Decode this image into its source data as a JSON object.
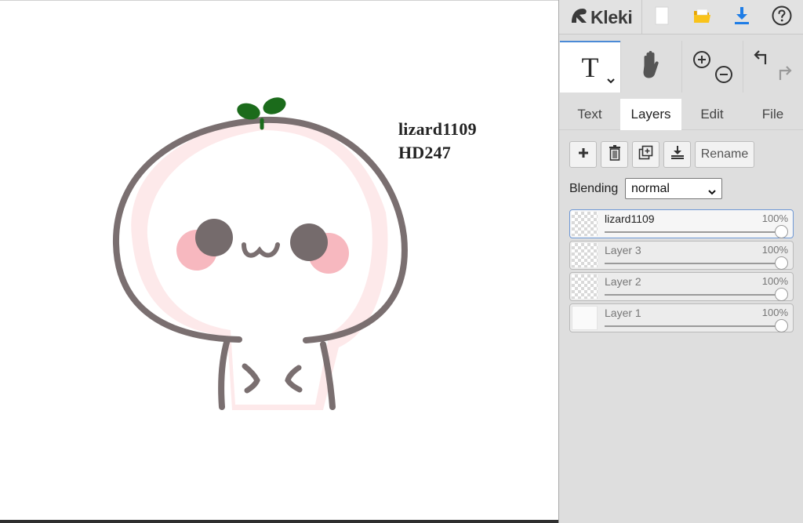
{
  "app": {
    "name": "Kleki"
  },
  "topbar": {
    "icons": [
      "kleki-logo-icon",
      "new-image-icon",
      "open-folder-icon",
      "download-icon",
      "help-icon"
    ],
    "colors": {
      "folder": "#f2b705",
      "download": "#1f7de6"
    }
  },
  "tools": {
    "active": "text",
    "items": [
      {
        "name": "text",
        "glyph": "T",
        "icon": "text-tool-icon"
      },
      {
        "name": "hand",
        "icon": "hand-icon"
      },
      {
        "name": "zoom",
        "icons": [
          "zoom-in-icon",
          "zoom-out-icon"
        ]
      },
      {
        "name": "history",
        "icons": [
          "undo-icon",
          "redo-icon"
        ]
      }
    ]
  },
  "tabs": [
    {
      "label": "Text",
      "active": false
    },
    {
      "label": "Layers",
      "active": true
    },
    {
      "label": "Edit",
      "active": false
    },
    {
      "label": "File",
      "active": false
    }
  ],
  "layers_panel": {
    "buttons": {
      "icons": [
        "add-layer-icon",
        "delete-layer-icon",
        "duplicate-layer-icon",
        "merge-down-icon"
      ],
      "rename_label": "Rename"
    },
    "blending": {
      "label": "Blending",
      "value": "normal"
    },
    "layers": [
      {
        "name": "lizard1109",
        "opacity_label": "100%",
        "opacity": 1.0,
        "active": true
      },
      {
        "name": "Layer 3",
        "opacity_label": "100%",
        "opacity": 1.0,
        "active": false
      },
      {
        "name": "Layer 2",
        "opacity_label": "100%",
        "opacity": 1.0,
        "active": false
      },
      {
        "name": "Layer 1",
        "opacity_label": "100%",
        "opacity": 1.0,
        "active": false
      }
    ]
  },
  "canvas": {
    "text_lines": [
      "lizard1109",
      "HD247"
    ],
    "colors": {
      "outline": "#7a6f70",
      "eyes": "#756b6c",
      "blush": "#f7b8bf",
      "sprout": "#1b6b1b",
      "body_shade": "#fde9ea"
    }
  }
}
